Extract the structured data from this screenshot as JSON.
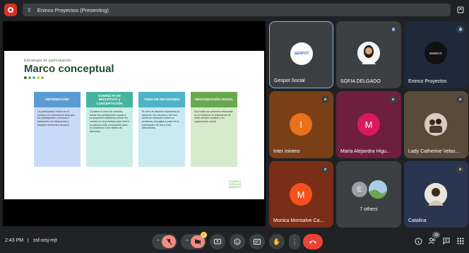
{
  "topbar": {
    "presenting_label": "Eninco Proyectos (Presenting)"
  },
  "slide": {
    "subtitle": "Estrategia de participación",
    "title": "Marco conceptual",
    "dot_colors": [
      "#3a6b35",
      "#6aa84f",
      "#4fb3c8",
      "#f1c232",
      "#93c47d"
    ],
    "cards": [
      {
        "head": "INFORMACIÓN",
        "color": "#5b9bd5",
        "body_color": "#c9daf8",
        "body": "La participación inicia con el acceso a la información para que los participantes conozcan e interpreten las situaciones y adopten elementos de juicio."
      },
      {
        "head": "CONSULTA DE INICIATIVAS y CONCERTACIÓN",
        "color": "#45b5a0",
        "body_color": "#c8ede5",
        "body": "Contiene el nivel de consulta, donde los participantes opinan y se proponen iniciativas a tener en cuenta en los procesos para definir la solución más conveniente para un problema o los medios de ejecución."
      },
      {
        "head": "TOMA DE DECISIONES",
        "color": "#4fb3c8",
        "body_color": "#c9eaf1",
        "body": "El nivel de decisión representa la adopción de una idea o de una forma de actuación sobre un problema, escogida a partir de la formulación de dos o más alternativas."
      },
      {
        "head": "ORGANIZACIÓN SOCIAL",
        "color": "#6aa84f",
        "body_color": "#d5ebcb",
        "body": "Son todas las acciones enfocadas en el fortalecer la articulación de entre actores sociales y su organización social."
      }
    ],
    "logo_text": "CONSEJO\nESPACIOS\nABIERTOS"
  },
  "participants": [
    {
      "name": "Gespot Social",
      "type": "logo",
      "logo_text": "GESPOT"
    },
    {
      "name": "SOFIA DELGADO",
      "type": "photo"
    },
    {
      "name": "Eninco Proyectos",
      "type": "logo",
      "logo_text": "ENINCO"
    },
    {
      "name": "Inter minero",
      "type": "initial",
      "initial": "I",
      "color": "#e8711a",
      "bg": "#7a3f17"
    },
    {
      "name": "Maria Alejandra Higu...",
      "type": "initial",
      "initial": "M",
      "color": "#d81b60",
      "bg": "#6e1f3e"
    },
    {
      "name": "Lady Catherine Velas...",
      "type": "photo2"
    },
    {
      "name": "Monica Monsalve Ca...",
      "type": "initial",
      "initial": "M",
      "color": "#f4511e",
      "bg": "#7a2e17"
    },
    {
      "name": "7 others",
      "type": "group",
      "initial": "E"
    },
    {
      "name": "Catalina",
      "type": "photo3"
    }
  ],
  "bottombar": {
    "time": "2:43 PM",
    "separator": "|",
    "meeting_code": "ssf-srsj-mjt",
    "people_count": "16"
  },
  "colors": {
    "bg": "#202124",
    "tile": "#3c4043",
    "accent_red": "#ea4335",
    "mic_off_red": "#f28b82"
  }
}
